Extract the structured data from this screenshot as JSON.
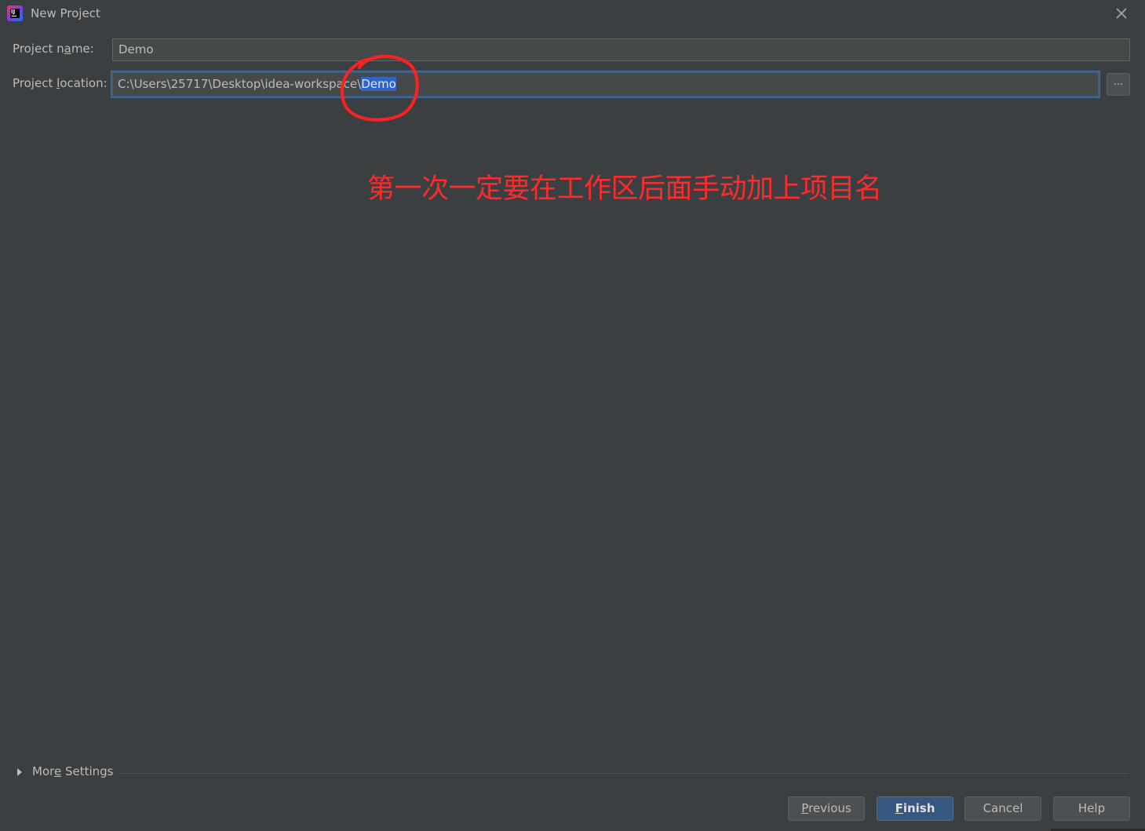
{
  "window": {
    "title": "New Project",
    "app_icon": "intellij-idea-icon",
    "close_icon": "close-icon"
  },
  "form": {
    "project_name": {
      "label_before": "Project n",
      "label_mnemonic": "a",
      "label_after": "me:",
      "value": "Demo"
    },
    "project_location": {
      "label_before": "Project ",
      "label_mnemonic": "l",
      "label_after": "ocation:",
      "value_prefix": "C:\\Users\\25717\\Desktop\\idea-workspace\\",
      "value_selected": "Demo",
      "browse_label": "..."
    }
  },
  "annotation": {
    "text": "第一次一定要在工作区后面手动加上项目名",
    "color": "#ff2a2a"
  },
  "more_settings": {
    "label_before": "Mor",
    "label_mnemonic": "e",
    "label_after": " Settings"
  },
  "buttons": {
    "previous": {
      "mnemonic": "P",
      "rest": "revious"
    },
    "finish": {
      "mnemonic": "F",
      "rest": "inish"
    },
    "cancel": "Cancel",
    "help": "Help"
  },
  "colors": {
    "background": "#3c3f41",
    "field_background": "#45494a",
    "focus_border": "#3d6185",
    "selection": "#2f65ca",
    "default_button": "#365880"
  }
}
